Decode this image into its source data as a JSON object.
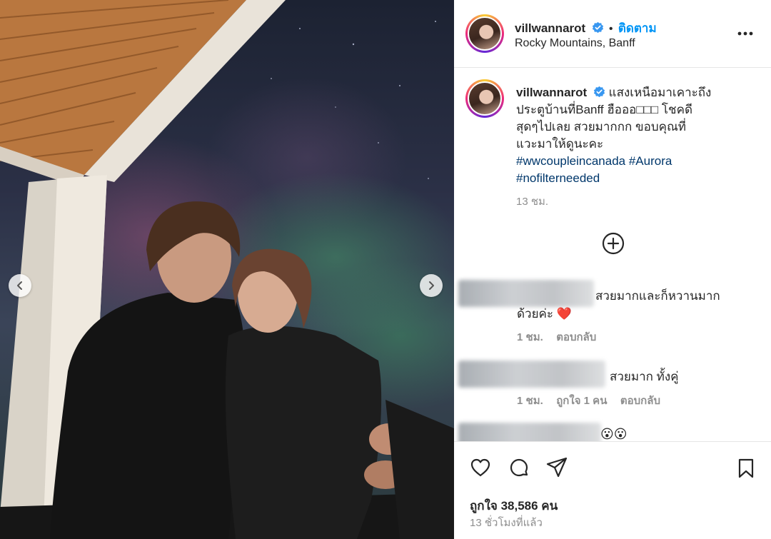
{
  "post": {
    "username": "villwannarot",
    "follow_label": "ติดตาม",
    "separator": "•",
    "location": "Rocky Mountains, Banff",
    "more_icon": "more-horizontal-icon"
  },
  "caption": {
    "username": "villwannarot",
    "lines": [
      "แสงเหนือมาเคาะถึง",
      "ประตูบ้านที่Banff ฮือออ□□□ โชคดี",
      "สุดๆไปเลย สวยมากกก ขอบคุณที่",
      "แวะมาให้ดูนะคะ"
    ],
    "hashtags": [
      "#wwcoupleincanada",
      "#Aurora",
      "#nofilterneeded"
    ],
    "time": "13 ชม."
  },
  "load_more_icon": "plus-circle-icon",
  "comments": [
    {
      "text_line1": "สวยมากและก็หวานมาก",
      "text_line2": "ด้วยค่ะ",
      "emoji": "❤️",
      "time": "1 ชม.",
      "reply": "ตอบกลับ"
    },
    {
      "text": "สวยมาก ทั้งคู่",
      "time": "1 ชม.",
      "likes": "ถูกใจ 1 คน",
      "reply": "ตอบกลับ"
    },
    {
      "emoji": "😮😮"
    }
  ],
  "actions": {
    "likes": "ถูกใจ 38,586 คน",
    "time_ago": "13 ชั่วโมงที่แล้ว"
  },
  "colors": {
    "link_blue": "#0095f6",
    "hashtag": "#00376b",
    "verified": "#3897f0",
    "muted": "#8e8e8e"
  }
}
